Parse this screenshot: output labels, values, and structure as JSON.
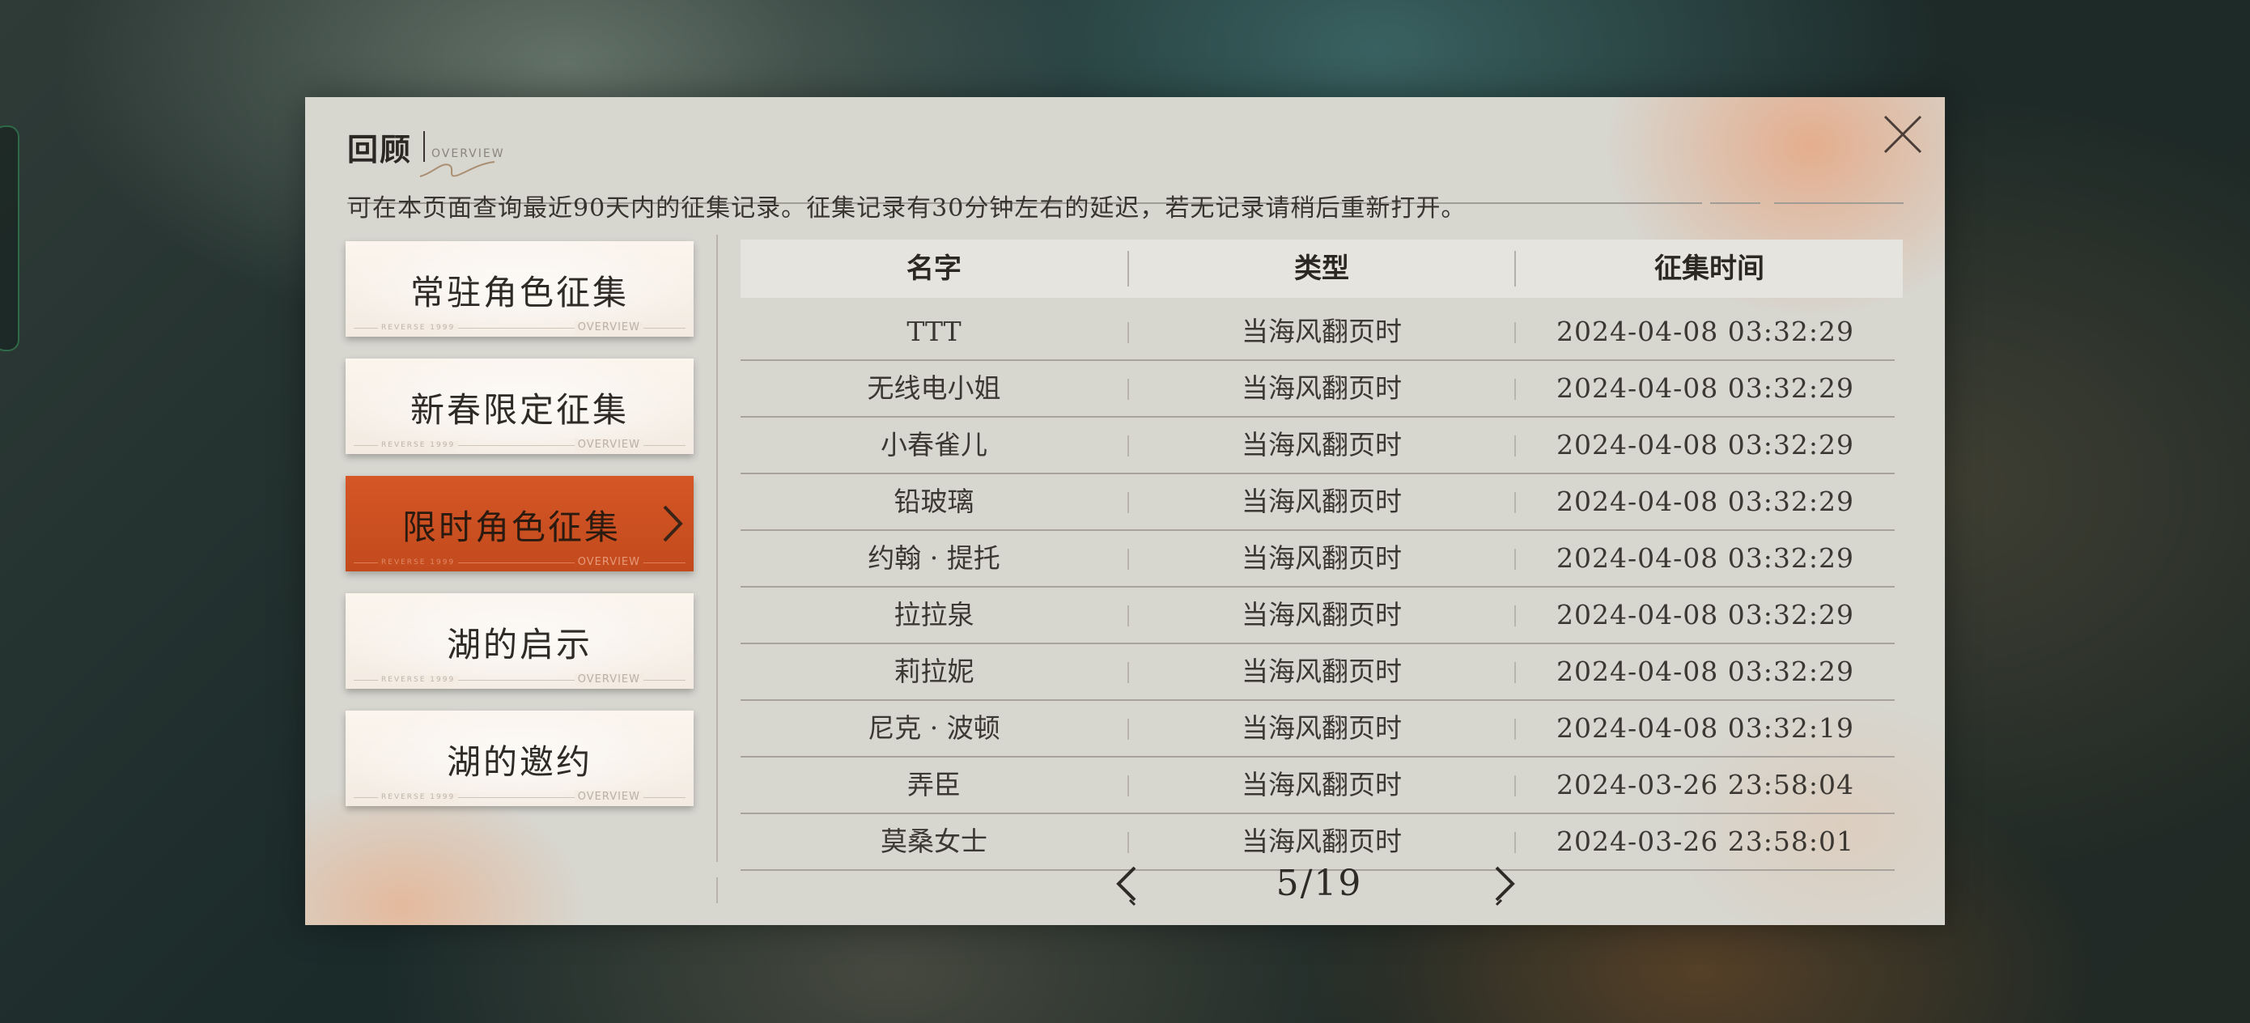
{
  "header": {
    "title": "回顾",
    "title_en": "OVERVIEW",
    "subtitle": "可在本页面查询最近90天内的征集记录。征集记录有30分钟左右的延迟，若无记录请稍后重新打开。"
  },
  "tabs": [
    {
      "label": "常驻角色征集",
      "footer": "OVERVIEW",
      "tiny": "REVERSE 1999",
      "active": false
    },
    {
      "label": "新春限定征集",
      "footer": "OVERVIEW",
      "tiny": "REVERSE 1999",
      "active": false
    },
    {
      "label": "限时角色征集",
      "footer": "OVERVIEW",
      "tiny": "REVERSE 1999",
      "active": true
    },
    {
      "label": "湖的启示",
      "footer": "OVERVIEW",
      "tiny": "REVERSE 1999",
      "active": false
    },
    {
      "label": "湖的邀约",
      "footer": "OVERVIEW",
      "tiny": "REVERSE 1999",
      "active": false
    }
  ],
  "table": {
    "columns": [
      "名字",
      "类型",
      "征集时间"
    ],
    "rows": [
      {
        "name": "TTT",
        "type": "当海风翻页时",
        "time": "2024-04-08 03:32:29"
      },
      {
        "name": "无线电小姐",
        "type": "当海风翻页时",
        "time": "2024-04-08 03:32:29"
      },
      {
        "name": "小春雀儿",
        "type": "当海风翻页时",
        "time": "2024-04-08 03:32:29"
      },
      {
        "name": "铅玻璃",
        "type": "当海风翻页时",
        "time": "2024-04-08 03:32:29"
      },
      {
        "name": "约翰 · 提托",
        "type": "当海风翻页时",
        "time": "2024-04-08 03:32:29"
      },
      {
        "name": "拉拉泉",
        "type": "当海风翻页时",
        "time": "2024-04-08 03:32:29"
      },
      {
        "name": "莉拉妮",
        "type": "当海风翻页时",
        "time": "2024-04-08 03:32:29"
      },
      {
        "name": "尼克 · 波顿",
        "type": "当海风翻页时",
        "time": "2024-04-08 03:32:19"
      },
      {
        "name": "弄臣",
        "type": "当海风翻页时",
        "time": "2024-03-26 23:58:04"
      },
      {
        "name": "莫桑女士",
        "type": "当海风翻页时",
        "time": "2024-03-26 23:58:01"
      }
    ]
  },
  "pager": {
    "text": "5/19",
    "current": 5,
    "total": 19
  },
  "colors": {
    "panel": "#d7d6cf",
    "active_tab": "#c9501f",
    "text": "#2e2a26"
  },
  "icons": {
    "close": "close-icon",
    "tab_arrow": "chevron-right-icon",
    "prev": "chevron-left-icon",
    "next": "chevron-right-icon"
  }
}
